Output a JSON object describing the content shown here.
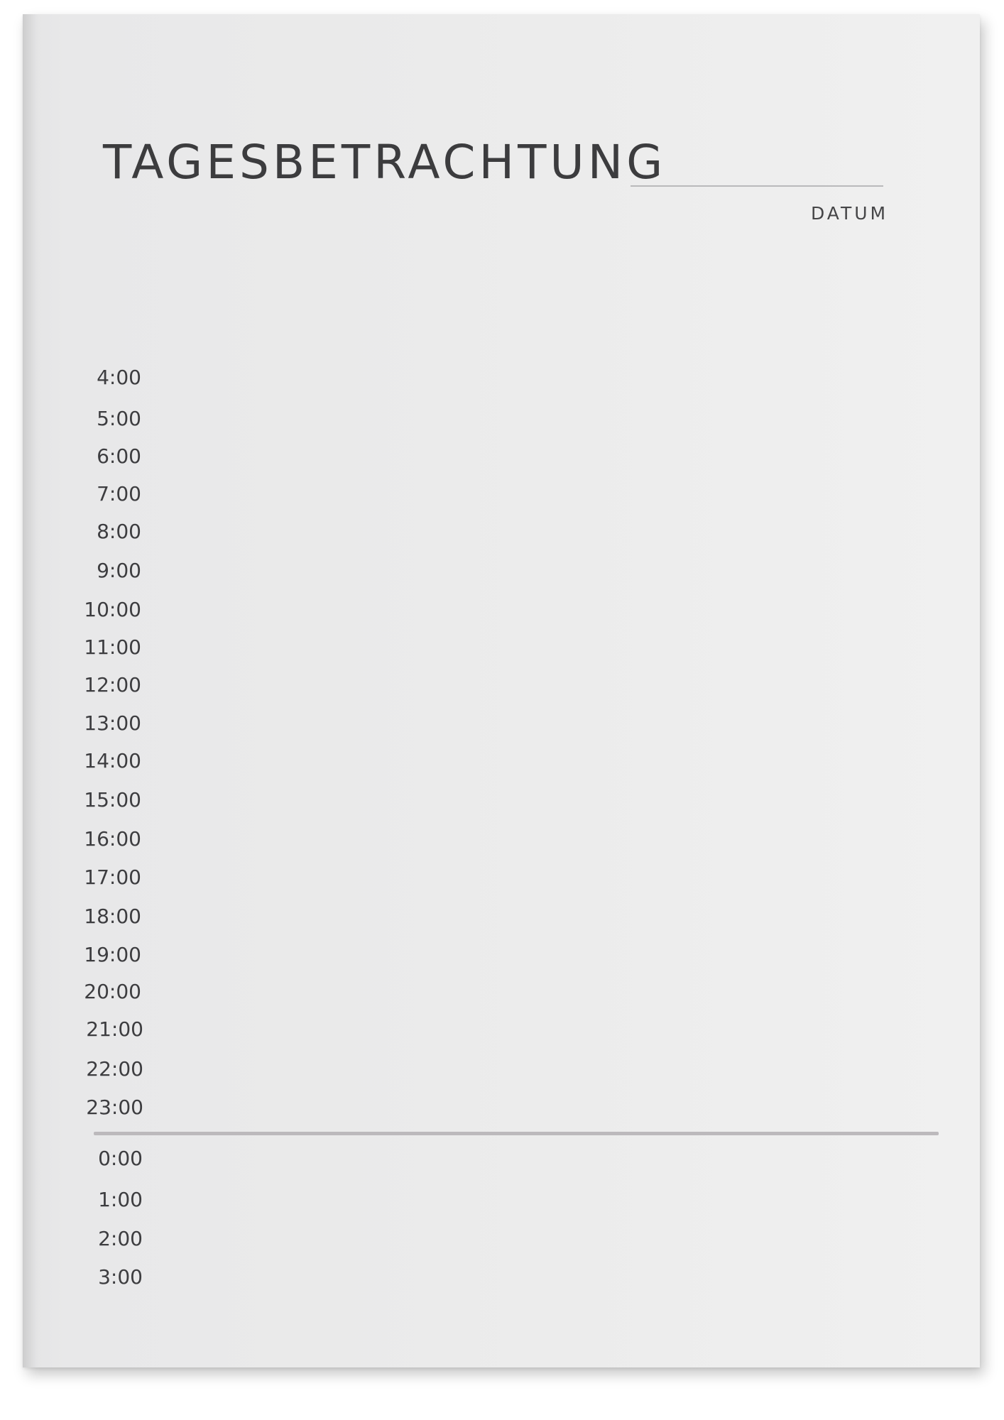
{
  "title": "TAGESBETRACHTUNG",
  "date_label": "DATUM",
  "hours": [
    "4:00",
    "5:00",
    "6:00",
    "7:00",
    "8:00",
    "9:00",
    "10:00",
    "11:00",
    "12:00",
    "13:00",
    "14:00",
    "15:00",
    "16:00",
    "17:00",
    "18:00",
    "19:00",
    "20:00",
    "21:00",
    "22:00",
    "23:00",
    "0:00",
    "1:00",
    "2:00",
    "3:00"
  ],
  "colors": {
    "text": "#3c3c3e",
    "paper": "#ebebeb",
    "divider": "#bcb9bc"
  }
}
